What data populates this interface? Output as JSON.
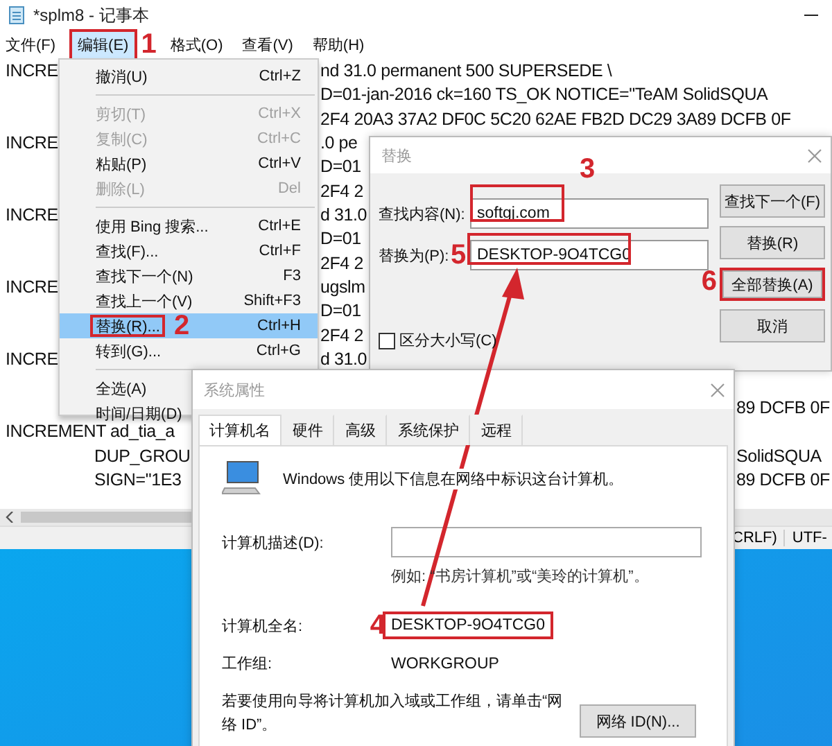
{
  "notepad": {
    "title": "*splm8 - 记事本",
    "menu": [
      {
        "label": "文件(F)",
        "selected": false
      },
      {
        "label": "编辑(E)",
        "selected": true
      },
      {
        "label": "格式(O)",
        "selected": false
      },
      {
        "label": "查看(V)",
        "selected": false
      },
      {
        "label": "帮助(H)",
        "selected": false
      }
    ],
    "lines_top": [
      {
        "left": "INCRE",
        "middle": "nd 31.0 permanent 500 SUPERSEDE \\"
      },
      {
        "middle": "D=01-jan-2016 ck=160 TS_OK NOTICE=\"TeAM SolidSQUA"
      },
      {
        "middle": "2F4 20A3 37A2 DF0C 5C20 62AE FB2D DC29 3A89 DCFB 0F"
      },
      {
        "left": "INCRE",
        "middle": ".0 pe"
      },
      {
        "middle": "D=01"
      },
      {
        "middle": "2F4 2"
      },
      {
        "left": "INCRE",
        "middle": "d 31.0"
      },
      {
        "middle": "D=01"
      },
      {
        "middle": "2F4 2"
      },
      {
        "left": "INCRE",
        "middle": "ugslm"
      },
      {
        "middle": "D=01"
      },
      {
        "middle": "2F4 2"
      },
      {
        "left": "INCRE",
        "middle": "d 31.0"
      }
    ],
    "lines_bottom": [
      {
        "right": "89 DCFB 0F"
      },
      {
        "left": "INCREMENT ad_tia_a"
      },
      {
        "indent": "DUP_GROU",
        "right": "SolidSQUA"
      },
      {
        "indent": "SIGN=\"1E3",
        "right": "89 DCFB 0F"
      }
    ],
    "status_bar": [
      "CRLF)",
      "UTF-"
    ]
  },
  "edit_menu": [
    {
      "kind": "item",
      "label": "撤消(U)",
      "shortcut": "Ctrl+Z",
      "disabled": false,
      "selected": false
    },
    {
      "kind": "separator"
    },
    {
      "kind": "item",
      "label": "剪切(T)",
      "shortcut": "Ctrl+X",
      "disabled": true,
      "selected": false
    },
    {
      "kind": "item",
      "label": "复制(C)",
      "shortcut": "Ctrl+C",
      "disabled": true,
      "selected": false
    },
    {
      "kind": "item",
      "label": "粘贴(P)",
      "shortcut": "Ctrl+V",
      "disabled": false,
      "selected": false
    },
    {
      "kind": "item",
      "label": "删除(L)",
      "shortcut": "Del",
      "disabled": true,
      "selected": false
    },
    {
      "kind": "separator"
    },
    {
      "kind": "item",
      "label": "使用 Bing 搜索...",
      "shortcut": "Ctrl+E",
      "disabled": false,
      "selected": false
    },
    {
      "kind": "item",
      "label": "查找(F)...",
      "shortcut": "Ctrl+F",
      "disabled": false,
      "selected": false
    },
    {
      "kind": "item",
      "label": "查找下一个(N)",
      "shortcut": "F3",
      "disabled": false,
      "selected": false
    },
    {
      "kind": "item",
      "label": "查找上一个(V)",
      "shortcut": "Shift+F3",
      "disabled": false,
      "selected": false
    },
    {
      "kind": "item",
      "label": "替换(R)...",
      "shortcut": "Ctrl+H",
      "disabled": false,
      "selected": true
    },
    {
      "kind": "item",
      "label": "转到(G)...",
      "shortcut": "Ctrl+G",
      "disabled": false,
      "selected": false
    },
    {
      "kind": "separator"
    },
    {
      "kind": "item",
      "label": "全选(A)",
      "disabled": false,
      "selected": false
    },
    {
      "kind": "item",
      "label": "时间/日期(D)",
      "disabled": false,
      "selected": false
    }
  ],
  "replace_dialog": {
    "title": "替换",
    "find_label": "查找内容(N):",
    "find_value": "softgj.com",
    "replace_label": "替换为(P):",
    "replace_value": "DESKTOP-9O4TCG0",
    "match_case": {
      "label": "区分大小写(C)",
      "checked": false
    },
    "buttons": [
      "查找下一个(F)",
      "替换(R)",
      "全部替换(A)",
      "取消"
    ]
  },
  "system_properties": {
    "title": "系统属性",
    "tabs": [
      {
        "label": "计算机名",
        "selected": true
      },
      {
        "label": "硬件",
        "selected": false
      },
      {
        "label": "高级",
        "selected": false
      },
      {
        "label": "系统保护",
        "selected": false
      },
      {
        "label": "远程",
        "selected": false
      }
    ],
    "intro": "Windows 使用以下信息在网络中标识这台计算机。",
    "description_label": "计算机描述(D):",
    "description_hint": "例如: “书房计算机”或“美玲的计算机”。",
    "full_name_label": "计算机全名:",
    "full_name": "DESKTOP-9O4TCG0",
    "workgroup_label": "工作组:",
    "workgroup": "WORKGROUP",
    "network_note": "若要使用向导将计算机加入域或工作组，请单击“网络 ID”。",
    "network_button": "网络 ID(N)..."
  },
  "annotations": [
    "1",
    "2",
    "3",
    "4",
    "5",
    "6"
  ]
}
